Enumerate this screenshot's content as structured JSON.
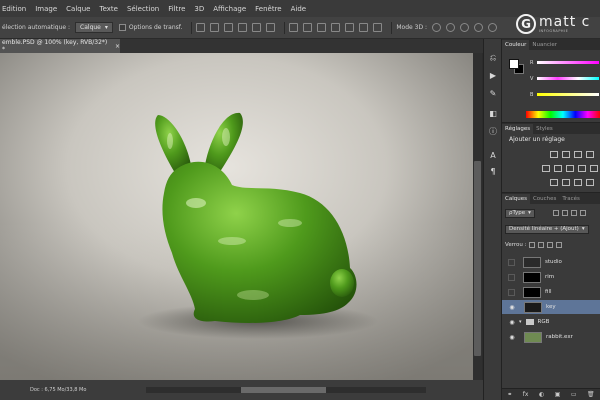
{
  "menu": [
    "Edition",
    "Image",
    "Calque",
    "Texte",
    "Sélection",
    "Filtre",
    "3D",
    "Affichage",
    "Fenêtre",
    "Aide"
  ],
  "options": {
    "auto_select_label": "élection automatique :",
    "auto_select_value": "Calque",
    "transform_label": "Options de transf.",
    "mode_3d_label": "Mode 3D :"
  },
  "watermark": {
    "letter": "G",
    "name": "matt c",
    "sub": "INFOGRAPHIE"
  },
  "document": {
    "tab_title": "emble.PSD @ 100% (key, RVB/32*) *",
    "close": "×"
  },
  "status": {
    "doc_size": "Doc : 6,75 Mo/33,8 Mo"
  },
  "colors": {
    "tabs": [
      "Couleur",
      "Nuancier"
    ],
    "fg": "#ffffff",
    "bg": "#000000",
    "sliders": [
      {
        "label": "R",
        "gradient": "linear-gradient(to right,#ffffff,#ff00ff)"
      },
      {
        "label": "V",
        "gradient": "linear-gradient(to right,#ffffff,#ff3dff,#ffffff,#00ffff)"
      },
      {
        "label": "B",
        "gradient": "linear-gradient(to right,#ffff00,#ffffff)"
      }
    ]
  },
  "adjustments": {
    "tabs": [
      "Réglages",
      "Styles"
    ],
    "title": "Ajouter un réglage"
  },
  "layers": {
    "tabs": [
      "Calques",
      "Couches",
      "Tracés"
    ],
    "filter_value": "Type",
    "blend_value": "Densité linéaire + (Ajout)",
    "lock_label": "Verrou :",
    "items": [
      {
        "name": "studio",
        "visible": false,
        "thumb": "#2a2a2a",
        "selected": false,
        "type": "layer"
      },
      {
        "name": "rim",
        "visible": false,
        "thumb": "#000000",
        "selected": false,
        "type": "layer"
      },
      {
        "name": "fill",
        "visible": false,
        "thumb": "#000000",
        "selected": false,
        "type": "layer"
      },
      {
        "name": "key",
        "visible": true,
        "thumb": "#1a1a1a",
        "selected": true,
        "type": "layer"
      },
      {
        "name": "RGB",
        "visible": true,
        "thumb": "",
        "selected": false,
        "type": "folder"
      },
      {
        "name": "rabbit.exr",
        "visible": true,
        "thumb": "#6f8a52",
        "selected": false,
        "type": "layer"
      }
    ],
    "footer": [
      "⚭",
      "fx",
      "◐",
      "▣",
      "▭",
      "🗑"
    ]
  }
}
